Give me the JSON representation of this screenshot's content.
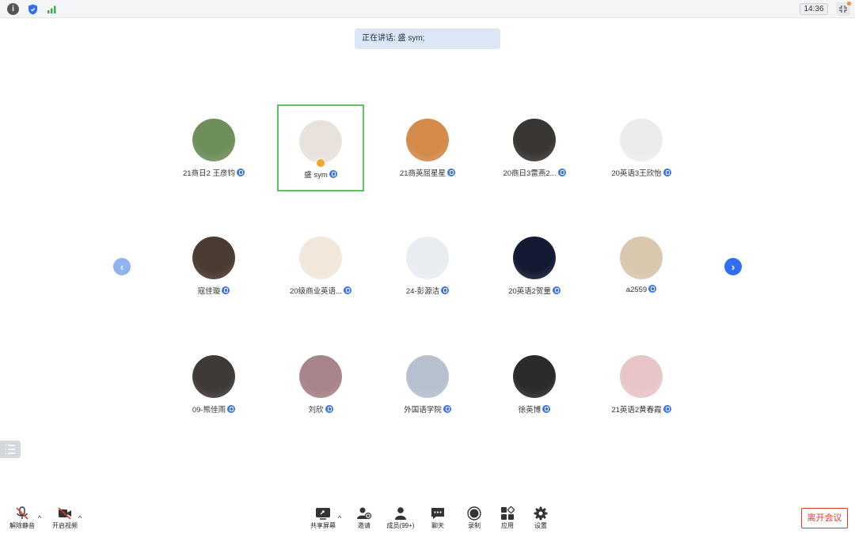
{
  "top_bar": {
    "clock": "14:36",
    "icons": [
      "info-icon",
      "shield-icon",
      "signal-icon",
      "fullscreen-exit-icon"
    ]
  },
  "speaking": {
    "text": "正在讲话: 盛 sym;"
  },
  "participants": [
    {
      "name": "21商日2 王彦钧",
      "avatar_color": "#6f8f5a",
      "active": false
    },
    {
      "name": "盛 sym",
      "avatar_color": "#e9e2dc",
      "active": true,
      "host": true
    },
    {
      "name": "21商英屈星星",
      "avatar_color": "#d38a4a",
      "active": false
    },
    {
      "name": "20商日3雷燕2...",
      "avatar_color": "#3a3634",
      "active": false
    },
    {
      "name": "20英语3王欣怡",
      "avatar_color": "#ececec",
      "active": false
    },
    {
      "name": "寇佳璇",
      "avatar_color": "#4a3b33",
      "active": false
    },
    {
      "name": "20级商业英语...",
      "avatar_color": "#f2e7db",
      "active": false
    },
    {
      "name": "24-彭源洁",
      "avatar_color": "#e9edf1",
      "active": false
    },
    {
      "name": "20英语2贺童",
      "avatar_color": "#151a33",
      "active": false
    },
    {
      "name": "a2559",
      "avatar_color": "#d9c7ae",
      "active": false
    },
    {
      "name": "09-熊佳雨",
      "avatar_color": "#3f3a38",
      "active": false
    },
    {
      "name": "刘欣",
      "avatar_color": "#a7848a",
      "active": false
    },
    {
      "name": "外国语学院",
      "avatar_color": "#b7c0cf",
      "active": false
    },
    {
      "name": "徐英博",
      "avatar_color": "#2c2a2a",
      "active": false
    },
    {
      "name": "21英语2黄春霞",
      "avatar_color": "#e8c6c8",
      "active": false
    }
  ],
  "toolbar": {
    "unmute": "解除静音",
    "start_video": "开启视频",
    "share_screen": "共享屏幕",
    "invite": "邀请",
    "members": "成员(99+)",
    "chat": "聊天",
    "record": "录制",
    "apps": "应用",
    "settings": "设置",
    "leave": "离开会议"
  },
  "colors": {
    "accent": "#2f6ff0",
    "active_border": "#5ac463",
    "leave": "#e03a2f",
    "host_badge": "#f5a32c"
  }
}
